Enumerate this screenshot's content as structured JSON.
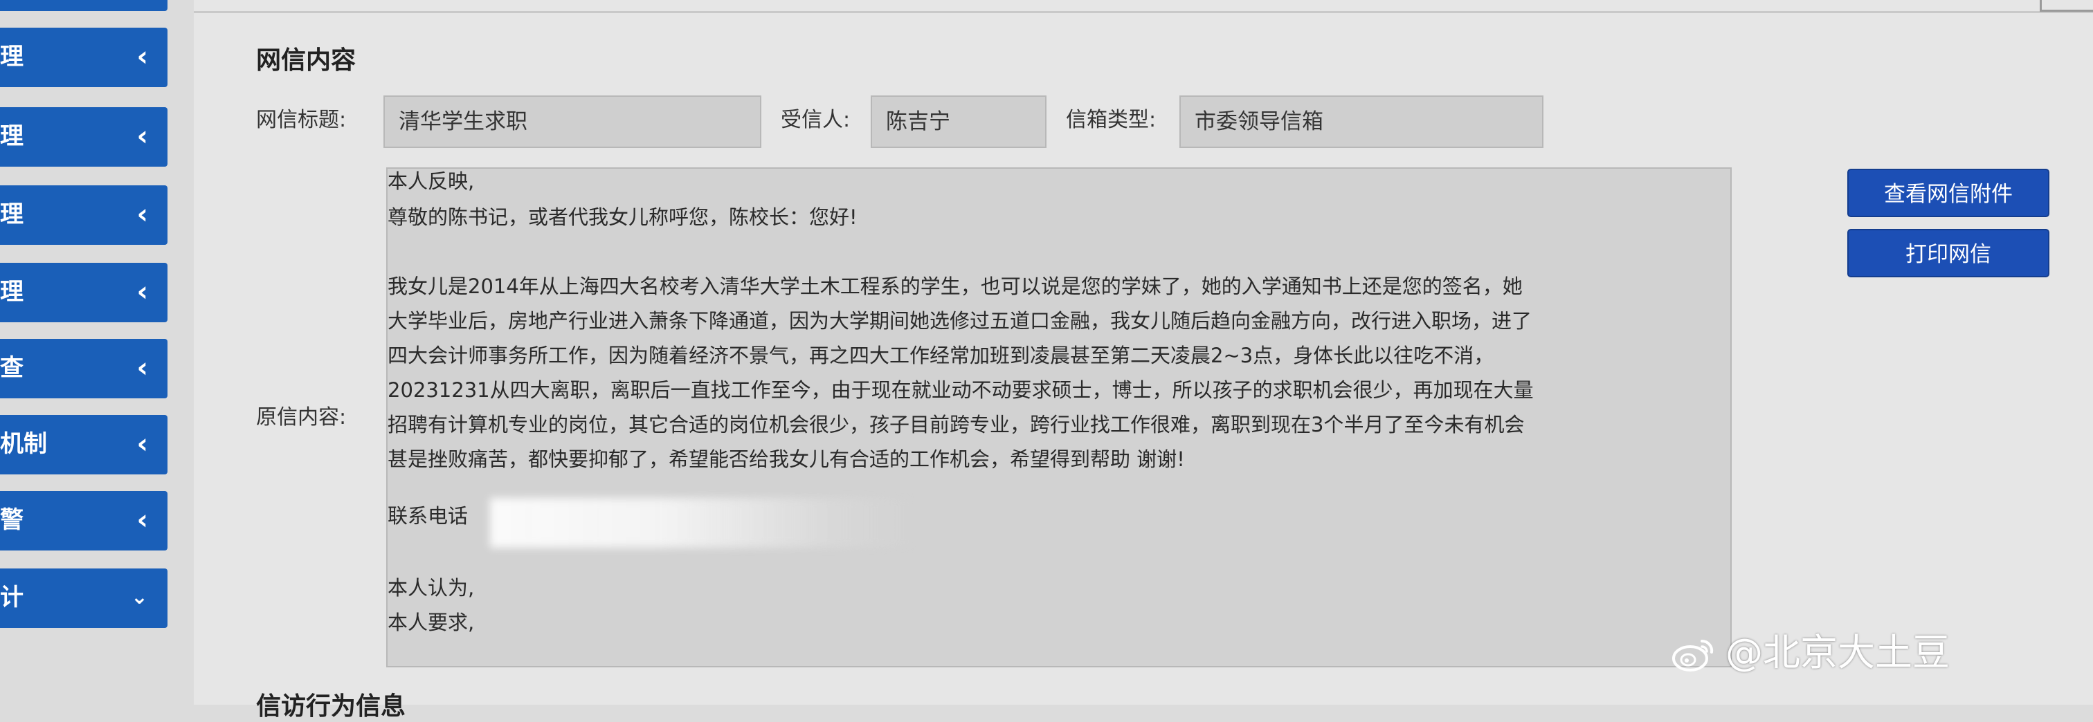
{
  "sidebar": {
    "items": [
      {
        "label": "理",
        "icon": "chevron-left-icon"
      },
      {
        "label": "理",
        "icon": "chevron-left-icon"
      },
      {
        "label": "理",
        "icon": "chevron-left-icon"
      },
      {
        "label": "理",
        "icon": "chevron-left-icon"
      },
      {
        "label": "查",
        "icon": "chevron-left-icon"
      },
      {
        "label": "机制",
        "icon": "chevron-left-icon"
      },
      {
        "label": "警",
        "icon": "chevron-left-icon"
      },
      {
        "label": "计",
        "icon": "chevron-down-icon"
      }
    ]
  },
  "main": {
    "section_title": "网信内容",
    "fields": {
      "title_label": "网信标题:",
      "title_value": "清华学生求职",
      "recipient_label": "受信人:",
      "recipient_value": "陈吉宁",
      "mailbox_label": "信箱类型:",
      "mailbox_value": "市委领导信箱",
      "content_label": "原信内容:"
    },
    "content_lines": [
      "本人反映,",
      "尊敬的陈书记，或者代我女儿称呼您，陈校长：您好!",
      "我女儿是2014年从上海四大名校考入清华大学土木工程系的学生，也可以说是您的学妹了，她的入学通知书上还是您的签名，她",
      "大学毕业后，房地产行业进入萧条下降通道，因为大学期间她选修过五道口金融，我女儿随后趋向金融方向，改行进入职场，进了",
      "四大会计师事务所工作，因为随着经济不景气，再之四大工作经常加班到凌晨甚至第二天凌晨2~3点，身体长此以往吃不消，",
      "20231231从四大离职，离职后一直找工作至今，由于现在就业动不动要求硕士，博士，所以孩子的求职机会很少，再加现在大量",
      "招聘有计算机专业的岗位，其它合适的岗位机会很少，孩子目前跨专业，跨行业找工作很难，离职到现在3个半月了至今未有机会",
      "甚是挫败痛苦，都快要抑郁了，希望能否给我女儿有合适的工作机会，希望得到帮助 谢谢!",
      "联系电话",
      "本人认为,",
      "本人要求,"
    ],
    "buttons": {
      "view_attachment": "查看网信附件",
      "print": "打印网信"
    },
    "next_section_title": "信访行为信息"
  },
  "watermark": {
    "text": "@北京大土豆",
    "icon": "weibo-icon"
  },
  "colors": {
    "sidebar_blue": "#1a5fb8",
    "button_blue": "#1c4fb5",
    "field_bg": "#cfcfcf"
  }
}
